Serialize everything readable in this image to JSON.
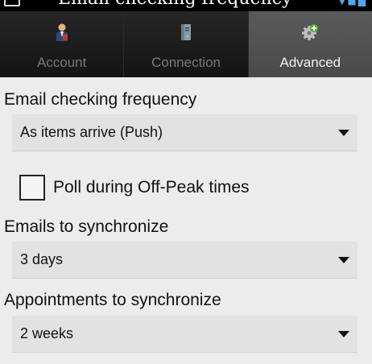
{
  "status_bar": {
    "overlay_text": "Email checking frequency"
  },
  "tabs": [
    {
      "label": "Account",
      "icon": "account-person-icon",
      "active": false
    },
    {
      "label": "Connection",
      "icon": "server-connection-icon",
      "active": false
    },
    {
      "label": "Advanced",
      "icon": "advanced-gear-icon",
      "active": true
    }
  ],
  "settings": {
    "email_checking_frequency": {
      "label": "Email checking frequency",
      "value": "As items arrive (Push)"
    },
    "poll_off_peak": {
      "label": "Poll during Off-Peak times",
      "checked": false
    },
    "emails_to_synchronize": {
      "label": "Emails to synchronize",
      "value": "3 days"
    },
    "appointments_to_synchronize": {
      "label": "Appointments to synchronize",
      "value": "2 weeks"
    }
  },
  "colors": {
    "tab_bar_bg": "#1a1a1a",
    "active_tab_bg": "#4f4f4f",
    "content_bg": "#ececec",
    "spinner_bg": "#e2e2e2",
    "accent_green": "#4caf2a"
  }
}
